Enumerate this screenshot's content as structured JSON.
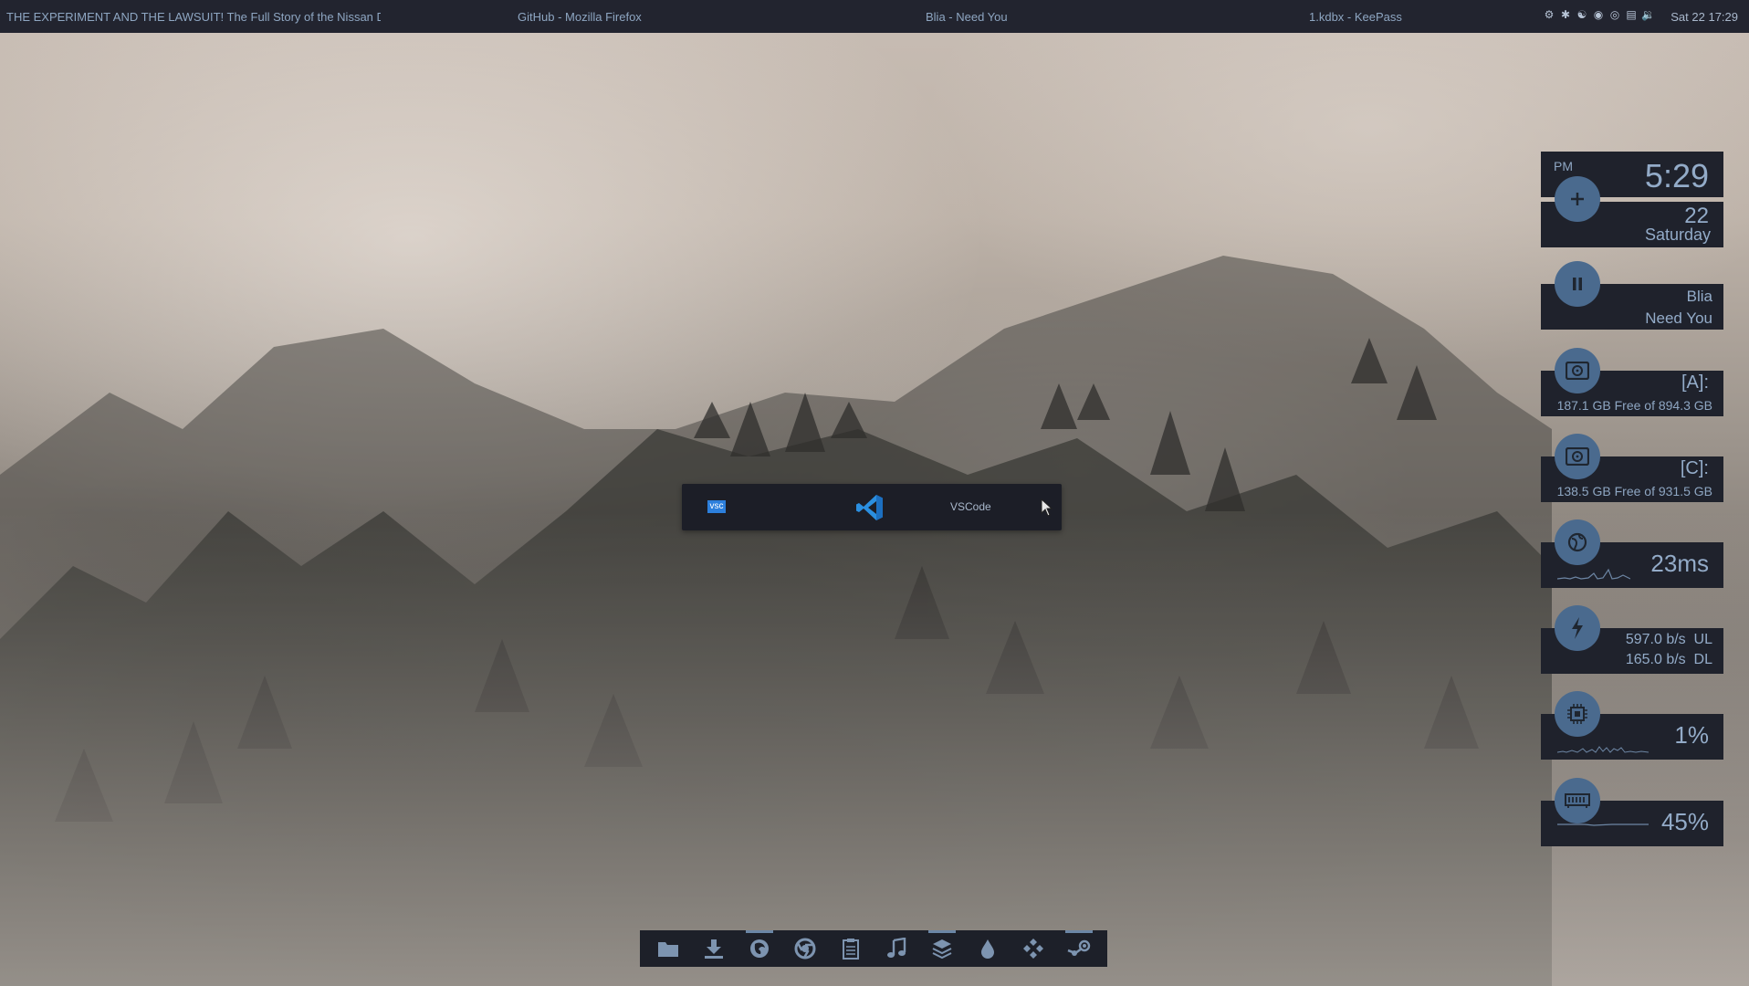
{
  "topbar": {
    "windows": [
      "THE EXPERIMENT AND THE LAWSUIT! The Full Story of the Nissan Delt...",
      "GitHub - Mozilla Firefox",
      "Blia - Need You",
      "1.kdbx - KeePass"
    ],
    "tray_icons": [
      "steam-icon",
      "bluetooth-icon",
      "discord-icon",
      "dropbox-icon",
      "chrome-icon",
      "network-icon",
      "volume-icon"
    ],
    "clock": "Sat 22 17:29"
  },
  "widgets": {
    "time": {
      "ampm": "PM",
      "time": "5:29",
      "day": "22",
      "weekday": "Saturday"
    },
    "music": {
      "artist": "Blia",
      "title": "Need You"
    },
    "disk_a": {
      "label": "[A]:",
      "info": "187.1 GB Free of 894.3 GB"
    },
    "disk_c": {
      "label": "[C]:",
      "info": "138.5 GB Free of 931.5 GB"
    },
    "ping": {
      "value": "23ms"
    },
    "network": {
      "ul": "597.0 b/s  UL",
      "dl": "165.0 b/s  DL"
    },
    "cpu": {
      "value": "1%"
    },
    "ram": {
      "value": "45%"
    }
  },
  "launcher": {
    "tag": "vsc",
    "app": "VSCode"
  },
  "dock": {
    "items": [
      "files-icon",
      "downloads-icon",
      "firefox-icon",
      "chrome-icon",
      "clipboard-icon",
      "music-icon",
      "layers-icon",
      "drop-icon",
      "kodi-icon",
      "steam-icon"
    ],
    "active": [
      2,
      6,
      9
    ]
  },
  "colors": {
    "panel": "#22242f",
    "widget": "#1f222c",
    "accent": "#4a6a8e",
    "text": "#8ea6c2"
  }
}
